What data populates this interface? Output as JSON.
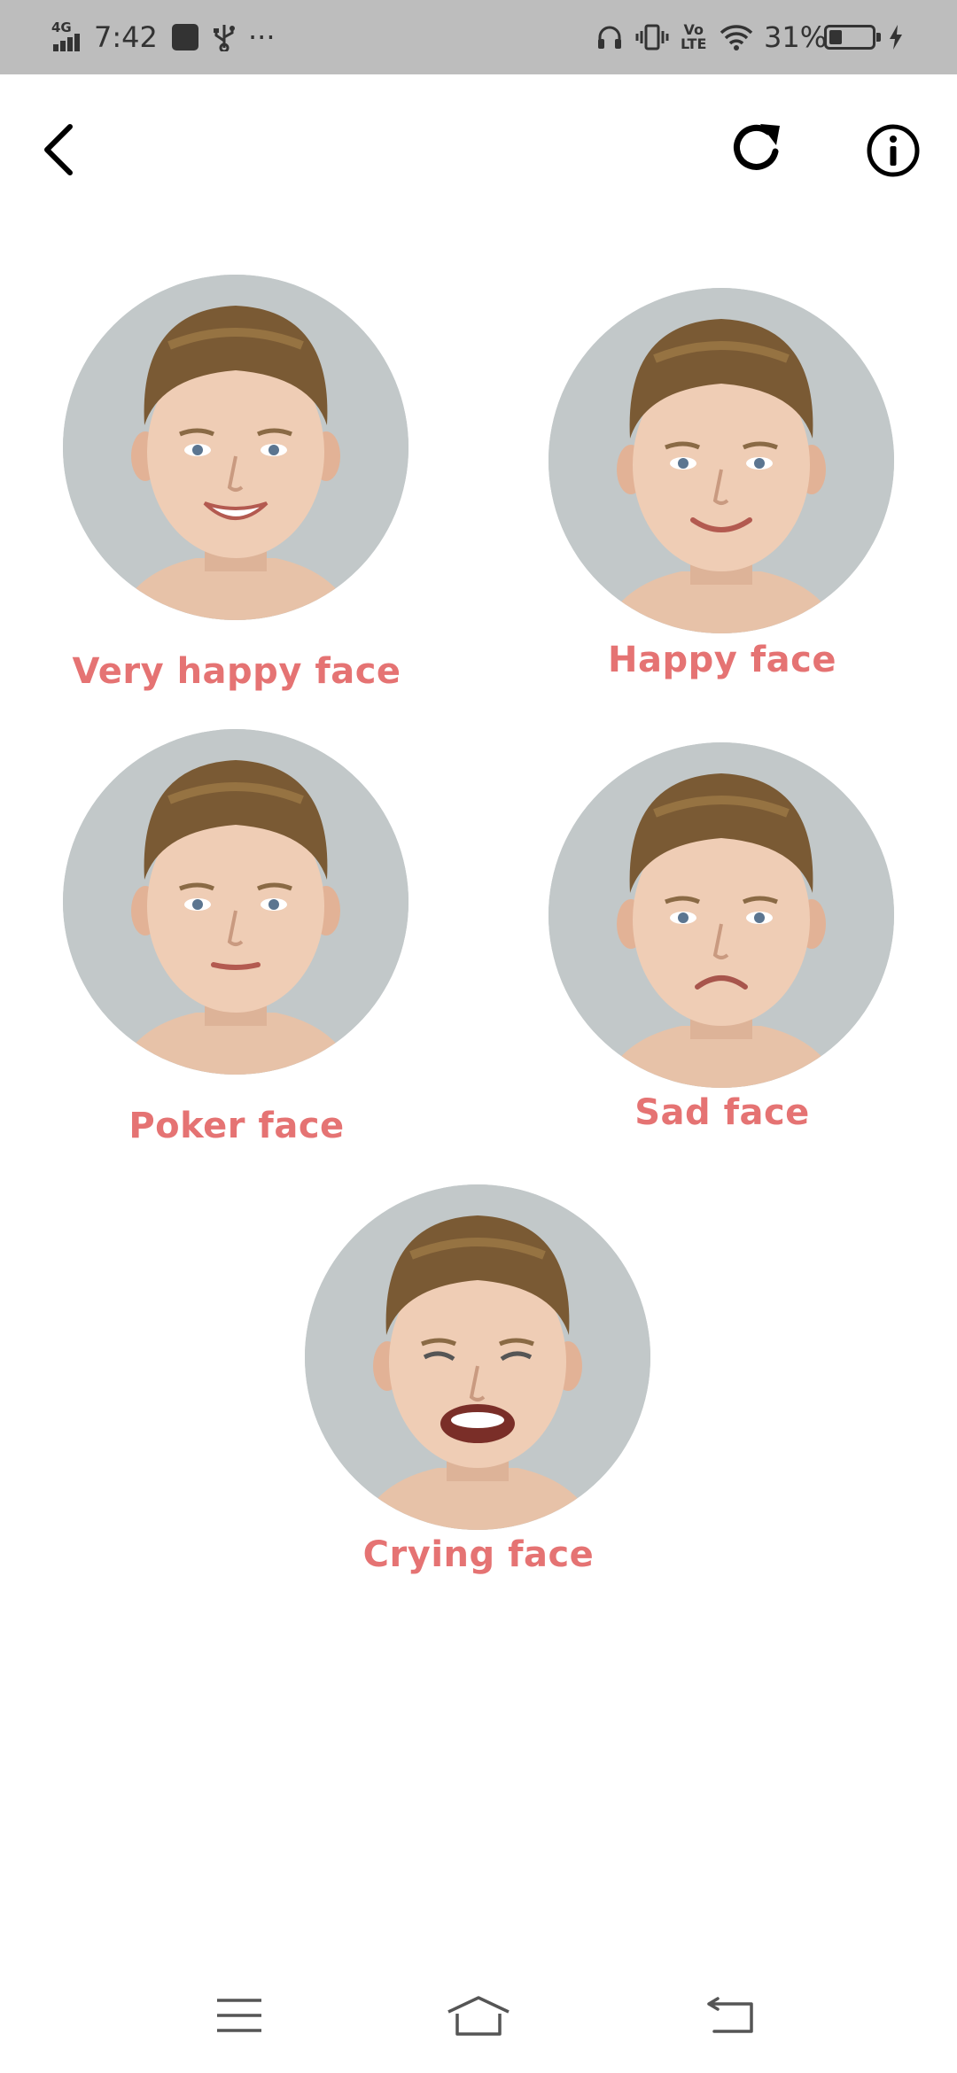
{
  "status_bar": {
    "network": "4G",
    "time": "7:42",
    "more": "···",
    "volte_top": "Vo",
    "volte_bottom": "LTE",
    "battery_percent": "31%",
    "battery_level": 0.31
  },
  "app_bar": {
    "back_icon": "chevron-left-icon",
    "refresh_icon": "refresh-icon",
    "info_icon": "info-icon"
  },
  "faces": [
    {
      "label": "Very happy face",
      "mouth": "big-smile"
    },
    {
      "label": "Happy face",
      "mouth": "smile"
    },
    {
      "label": "Poker face",
      "mouth": "neutral"
    },
    {
      "label": "Sad face",
      "mouth": "frown"
    },
    {
      "label": "Crying face",
      "mouth": "cry"
    }
  ],
  "colors": {
    "label": "#e57373",
    "status_bar": "#bdbdbd",
    "face_background": "#c2c8c9"
  },
  "nav_bar": {
    "menu_icon": "menu-icon",
    "home_icon": "home-icon",
    "back_icon": "back-icon"
  }
}
